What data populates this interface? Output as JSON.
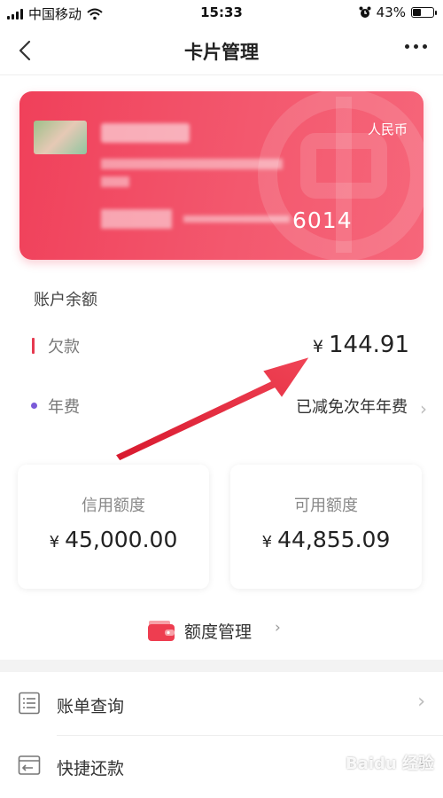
{
  "status_bar": {
    "carrier": "中国移动",
    "time": "15:33",
    "battery_percent": "43%",
    "battery_level": 0.43
  },
  "nav": {
    "title": "卡片管理"
  },
  "card": {
    "currency": "人民币",
    "number_tail": "6014",
    "colors": {
      "start": "#f0405a",
      "end": "#f6667a"
    }
  },
  "account": {
    "section_title": "账户余额",
    "debt_label": "欠款",
    "debt_currency": "¥",
    "debt_amount": "144.91",
    "fee_label": "年费",
    "fee_value": "已减免次年年费"
  },
  "limits": {
    "credit_label": "信用额度",
    "credit_currency": "¥",
    "credit_value": "45,000.00",
    "available_label": "可用额度",
    "available_currency": "¥",
    "available_value": "44,855.09"
  },
  "limit_management": {
    "label": "额度管理"
  },
  "menu": [
    {
      "label": "账单查询",
      "icon": "bill-list-icon"
    },
    {
      "label": "快捷还款",
      "icon": "quick-repay-icon"
    }
  ],
  "watermark": "Baidu 经验",
  "colors": {
    "accent": "#e63a50",
    "fee_dot": "#7a5ad8",
    "arrow": "#e8283c"
  }
}
